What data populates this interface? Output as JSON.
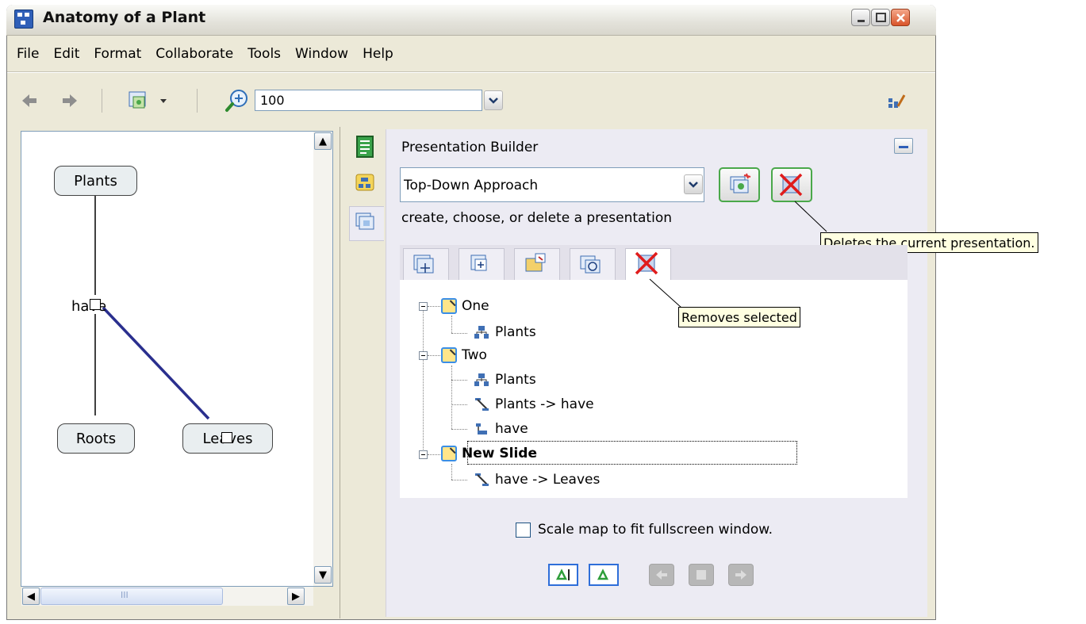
{
  "window": {
    "title": "Anatomy of a Plant"
  },
  "menu": [
    "File",
    "Edit",
    "Format",
    "Collaborate",
    "Tools",
    "Window",
    "Help"
  ],
  "toolbar": {
    "zoom_value": "100"
  },
  "map": {
    "nodes": {
      "plants": "Plants",
      "linking_phrase": "have",
      "roots": "Roots",
      "leaves": "Leaves"
    },
    "hscroll_grip": "III"
  },
  "presentation_builder": {
    "header": "Presentation Builder",
    "selected_presentation": "Top-Down Approach",
    "hint": "create, choose, or delete a presentation",
    "delete_tooltip": "Deletes the current presentation.",
    "remove_tooltip": "Removes selected",
    "slides": [
      {
        "label": "One",
        "bold": false,
        "children": [
          {
            "type": "concept",
            "label": "Plants"
          }
        ]
      },
      {
        "label": "Two",
        "bold": false,
        "children": [
          {
            "type": "concept",
            "label": "Plants"
          },
          {
            "type": "link",
            "label": "Plants -> have"
          },
          {
            "type": "linkphrase",
            "label": "have"
          }
        ]
      },
      {
        "label": "New Slide",
        "bold": true,
        "children": [
          {
            "type": "link",
            "label": "have -> Leaves"
          }
        ]
      }
    ],
    "scale_label": "Scale map to fit fullscreen window.",
    "scale_checked": false
  },
  "colors": {
    "window_bg": "#ece9d8",
    "panel_bg": "#ecebf3",
    "accent_green": "#4aa84a",
    "link_blue": "#2a2f8e",
    "tooltip_bg": "#ffffe1"
  }
}
